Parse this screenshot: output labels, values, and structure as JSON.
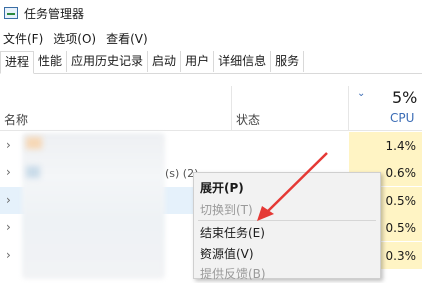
{
  "window": {
    "title": "任务管理器"
  },
  "menubar": [
    "文件(F)",
    "选项(O)",
    "查看(V)"
  ],
  "tabs": [
    "进程",
    "性能",
    "应用历史记录",
    "启动",
    "用户",
    "详细信息",
    "服务"
  ],
  "active_tab": "进程",
  "columns": {
    "name": "名称",
    "status": "状态",
    "cpu_total": "5%",
    "cpu": "CPU"
  },
  "rows": [
    {
      "cpu": "1.4%"
    },
    {
      "cpu": "0.6%"
    },
    {
      "cpu": "0.5%"
    },
    {
      "cpu": "0.5%"
    },
    {
      "cpu": "0.3%"
    }
  ],
  "partial_text": "(s) (2)",
  "context_menu": {
    "items": [
      {
        "label": "展开(P)",
        "bold": true,
        "disabled": false
      },
      {
        "label": "切换到(T)",
        "bold": false,
        "disabled": true
      },
      {
        "label": "结束任务(E)",
        "bold": false,
        "disabled": false
      },
      {
        "label": "资源值(V)",
        "bold": false,
        "disabled": false,
        "submenu": true
      },
      {
        "label": "提供反馈(B)",
        "bold": false,
        "disabled": true
      }
    ]
  },
  "colors": {
    "accent": "#3b6cb5",
    "cpu_highlight": "#fff4c4",
    "selection": "#e5f1fb",
    "annotation_arrow": "#e53935"
  },
  "icons": {
    "app": "task-manager-icon",
    "sort": "chevron-down-icon",
    "expand": "chevron-right-icon",
    "submenu": "chevron-right-icon"
  }
}
